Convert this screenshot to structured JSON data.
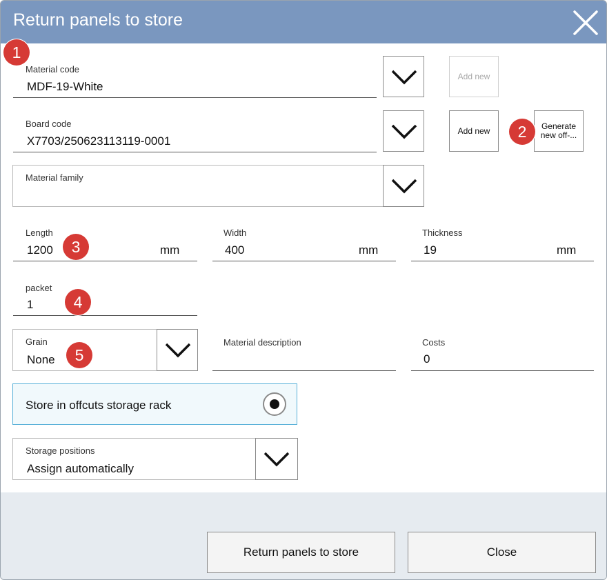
{
  "dialog": {
    "title": "Return panels to store",
    "close_icon": "close-icon"
  },
  "material_code": {
    "label": "Material code",
    "value": "MDF-19-White",
    "add_new_label": "Add new"
  },
  "board_code": {
    "label": "Board code",
    "value": "X7703/250623113119-0001",
    "add_new_label": "Add new",
    "generate_line1": "Generate",
    "generate_line2": "new off-..."
  },
  "material_family": {
    "label": "Material family",
    "value": ""
  },
  "length": {
    "label": "Length",
    "value": "1200",
    "unit": "mm"
  },
  "width": {
    "label": "Width",
    "value": "400",
    "unit": "mm"
  },
  "thickness": {
    "label": "Thickness",
    "value": "19",
    "unit": "mm"
  },
  "packet": {
    "label": "packet",
    "value": "1"
  },
  "grain": {
    "label": "Grain",
    "value": "None"
  },
  "material_description": {
    "label": "Material description",
    "value": ""
  },
  "costs": {
    "label": "Costs",
    "value": "0"
  },
  "store_offcuts": {
    "label": "Store in offcuts storage rack",
    "selected": true
  },
  "storage_positions": {
    "label": "Storage positions",
    "value": "Assign automatically"
  },
  "footer": {
    "return_label": "Return panels to store",
    "close_label": "Close"
  },
  "badges": [
    "1",
    "2",
    "3",
    "4",
    "5"
  ],
  "colors": {
    "title_bar": "#7a97bf",
    "badge": "#d63a35",
    "highlight_border": "#58b0d8",
    "footer": "#e6ebf0"
  }
}
